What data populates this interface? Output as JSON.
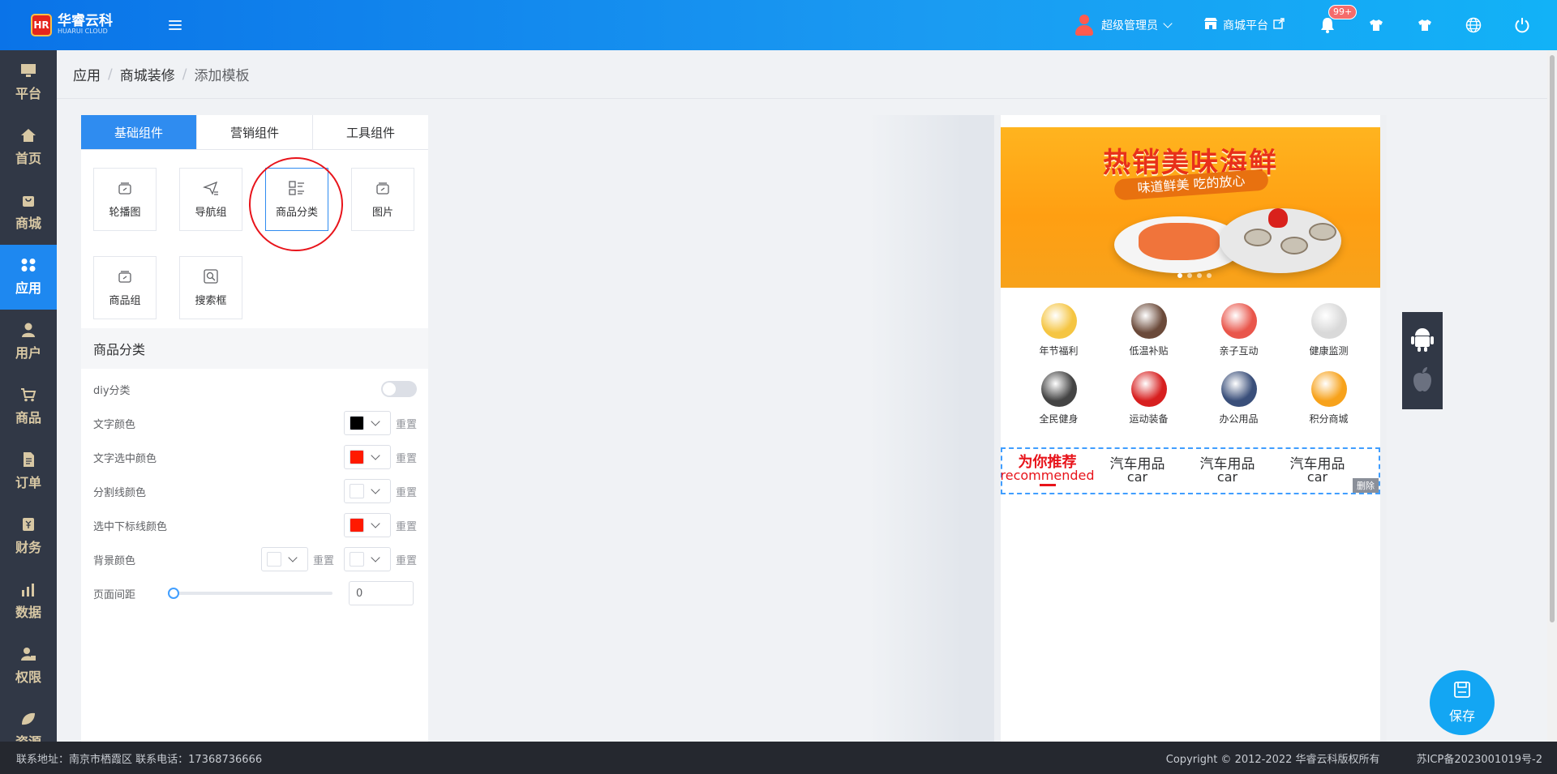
{
  "brand": {
    "mark": "HR",
    "name": "华睿云科",
    "subtitle": "HUARUI CLOUD"
  },
  "header": {
    "user_name": "超级管理员",
    "shop_link": "商城平台",
    "notification_badge": "99+",
    "icons": [
      "menu-fold-icon",
      "bell-icon",
      "shirt-icon",
      "shirt-icon",
      "globe-icon",
      "power-icon"
    ]
  },
  "sidebar": {
    "items": [
      {
        "label": "平台",
        "icon": "monitor-icon"
      },
      {
        "label": "首页",
        "icon": "home-icon"
      },
      {
        "label": "商城",
        "icon": "shopping-bag-icon"
      },
      {
        "label": "应用",
        "icon": "apps-icon"
      },
      {
        "label": "用户",
        "icon": "user-icon"
      },
      {
        "label": "商品",
        "icon": "cart-icon"
      },
      {
        "label": "订单",
        "icon": "document-icon"
      },
      {
        "label": "财务",
        "icon": "finance-icon"
      },
      {
        "label": "数据",
        "icon": "chart-icon"
      },
      {
        "label": "权限",
        "icon": "lock-user-icon"
      },
      {
        "label": "资源",
        "icon": "leaf-icon"
      }
    ],
    "active_index": 3,
    "active_color": "#1e88f0"
  },
  "breadcrumb": {
    "items": [
      "应用",
      "商城装修",
      "添加模板"
    ],
    "separator": "/"
  },
  "panel": {
    "tabs": [
      "基础组件",
      "营销组件",
      "工具组件"
    ],
    "active_tab": 0,
    "components": [
      {
        "label": "轮播图",
        "icon": "carousel-icon"
      },
      {
        "label": "导航组",
        "icon": "nav-icon"
      },
      {
        "label": "商品分类",
        "icon": "category-icon"
      },
      {
        "label": "图片",
        "icon": "image-icon"
      },
      {
        "label": "商品组",
        "icon": "goods-group-icon"
      },
      {
        "label": "搜索框",
        "icon": "search-box-icon"
      }
    ],
    "selected_component": 2
  },
  "settings": {
    "title": "商品分类",
    "diy_label": "diy分类",
    "diy_enabled": false,
    "text_color_label": "文字颜色",
    "text_color": "#000000",
    "text_selected_color_label": "文字选中颜色",
    "text_selected_color": "#ff1a00",
    "divider_color_label": "分割线颜色",
    "divider_color": "#ffffff",
    "underline_color_label": "选中下标线颜色",
    "underline_color": "#ff1a00",
    "bg_color_label": "背景颜色",
    "bg_color_1": "#ffffff",
    "bg_color_2": "#ffffff",
    "page_margin_label": "页面间距",
    "page_margin_value": "0",
    "page_margin_fraction": 0,
    "reset_label": "重置"
  },
  "preview": {
    "banner_title": "热销美味海鲜",
    "banner_subtitle": "味道鲜美 吃的放心",
    "nav_items": [
      {
        "label": "年节福利",
        "color": "#f5c542"
      },
      {
        "label": "低温补贴",
        "color": "#6b4a3a"
      },
      {
        "label": "亲子互动",
        "color": "#e9564b"
      },
      {
        "label": "健康监测",
        "color": "#d9d9d9"
      },
      {
        "label": "全民健身",
        "color": "#444444"
      },
      {
        "label": "运动装备",
        "color": "#d71f1f"
      },
      {
        "label": "办公用品",
        "color": "#3a4f7a"
      },
      {
        "label": "积分商城",
        "color": "#f7a21b"
      }
    ],
    "categories": [
      {
        "zh": "为你推荐",
        "en": "recommended"
      },
      {
        "zh": "汽车用品",
        "en": "car"
      },
      {
        "zh": "汽车用品",
        "en": "car"
      },
      {
        "zh": "汽车用品",
        "en": "car"
      }
    ],
    "active_category": 0,
    "delete_label": "删除"
  },
  "save_label": "保存",
  "footer": {
    "contact": "联系地址：南京市栖霞区 联系电话：17368736666",
    "copyright": "Copyright © 2012-2022 华睿云科版权所有",
    "icp": "苏ICP备2023001019号-2"
  }
}
